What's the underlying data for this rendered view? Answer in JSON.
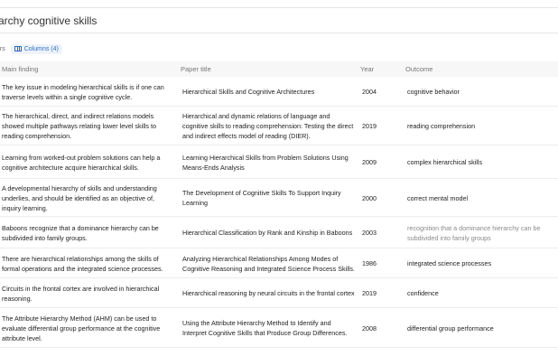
{
  "header": {
    "title": "rarchy cognitive skills"
  },
  "toolbar": {
    "filters_label": "ers",
    "columns_label": "Columns (4)"
  },
  "table": {
    "columns": [
      "Main finding",
      "Paper title",
      "Year",
      "Outcome"
    ],
    "rows": [
      {
        "finding": "The key issue in modeling hierarchical skills is if one can traverse levels within a single cognitive cycle.",
        "paper": "Hierarchical Skills and Cognitive Architectures",
        "year": "2004",
        "outcome": "cognitive behavior"
      },
      {
        "finding": "The hierarchical, direct, and indirect relations models showed multiple pathways relating lower level skills to reading comprehension.",
        "paper": "Hierarchical and dynamic relations of language and cognitive skills to reading comprehension: Testing the direct and indirect effects model of reading (DIER).",
        "year": "2019",
        "outcome": "reading comprehension"
      },
      {
        "finding": "Learning from worked-out problem solutions can help a cognitive architecture acquire hierarchical skills.",
        "paper": "Learning Hierarchical Skills from Problem Solutions Using Means-Ends Analysis",
        "year": "2009",
        "outcome": "complex hierarchical skills"
      },
      {
        "finding": "A developmental hierarchy of skills and understanding underlies, and should be identified as an objective of, inquiry learning.",
        "paper": "The Development of Cognitive Skills To Support Inquiry Learning",
        "year": "2000",
        "outcome": "correct mental model"
      },
      {
        "finding": "Baboons recognize that a dominance hierarchy can be subdivided into family groups.",
        "paper": "Hierarchical Classification by Rank and Kinship in Baboons",
        "year": "2003",
        "outcome": "recognition that a dominance hierarchy can be subdivided into family groups"
      },
      {
        "finding": "There are hierarchical relationships among the skills of formal operations and the integrated science processes.",
        "paper": "Analyzing Hierarchical Relationships Among Modes of Cognitive Reasoning and Integrated Science Process Skills.",
        "year": "1986",
        "outcome": "integrated science processes"
      },
      {
        "finding": "Circuits in the frontal cortex are involved in hierarchical reasoning.",
        "paper": "Hierarchical reasoning by neural circuits in the frontal cortex",
        "year": "2019",
        "outcome": "confidence"
      },
      {
        "finding": "The Attribute Hierarchy Method (AHM) can be used to evaluate differential group performance at the cognitive attribute level.",
        "paper": "Using the Attribute Hierarchy Method to Identify and Interpret Cognitive Skills that Produce Group Differences.",
        "year": "2008",
        "outcome": "differential group performance"
      }
    ]
  }
}
